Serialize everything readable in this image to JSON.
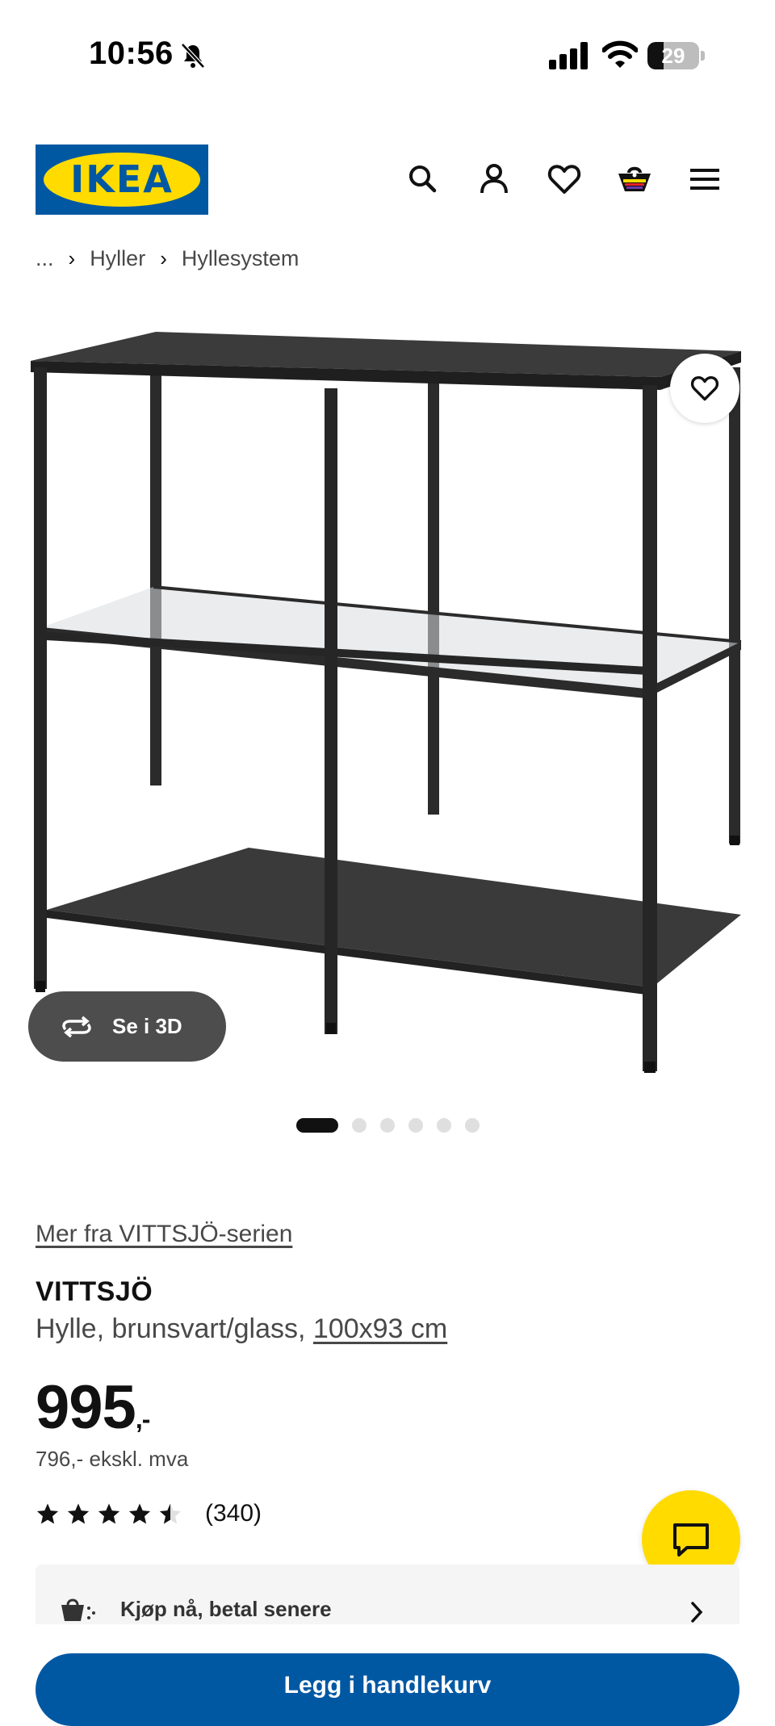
{
  "status_bar": {
    "time": "10:56",
    "battery_level": "29",
    "icons": [
      "bell-muted-icon",
      "signal-icon",
      "wifi-icon",
      "battery-icon"
    ]
  },
  "header": {
    "logo_text": "IKEA",
    "icons": [
      "search-icon",
      "account-icon",
      "heart-icon",
      "cart-icon",
      "menu-icon"
    ],
    "colors": {
      "brand_blue": "#0058a3",
      "brand_yellow": "#ffdb00"
    }
  },
  "breadcrumb": {
    "items": [
      "...",
      "Hyller",
      "Hyllesystem"
    ]
  },
  "gallery": {
    "see_3d_label": "Se i 3D",
    "image_count": 6,
    "active_index": 0
  },
  "product": {
    "series_link": "Mer fra VITTSJÖ-serien",
    "name": "VITTSJÖ",
    "description": "Hylle, brunsvart/glass, ",
    "size": "100x93 cm",
    "price": "995",
    "price_suffix": ",-",
    "price_ex_vat": "796,- ekskl. mva",
    "rating": 4.5,
    "rating_max": 5,
    "review_count": "(340)"
  },
  "bnpl": {
    "label": "Kjøp nå, betal senere"
  },
  "actions": {
    "add_to_cart": "Legg i handlekurv"
  }
}
